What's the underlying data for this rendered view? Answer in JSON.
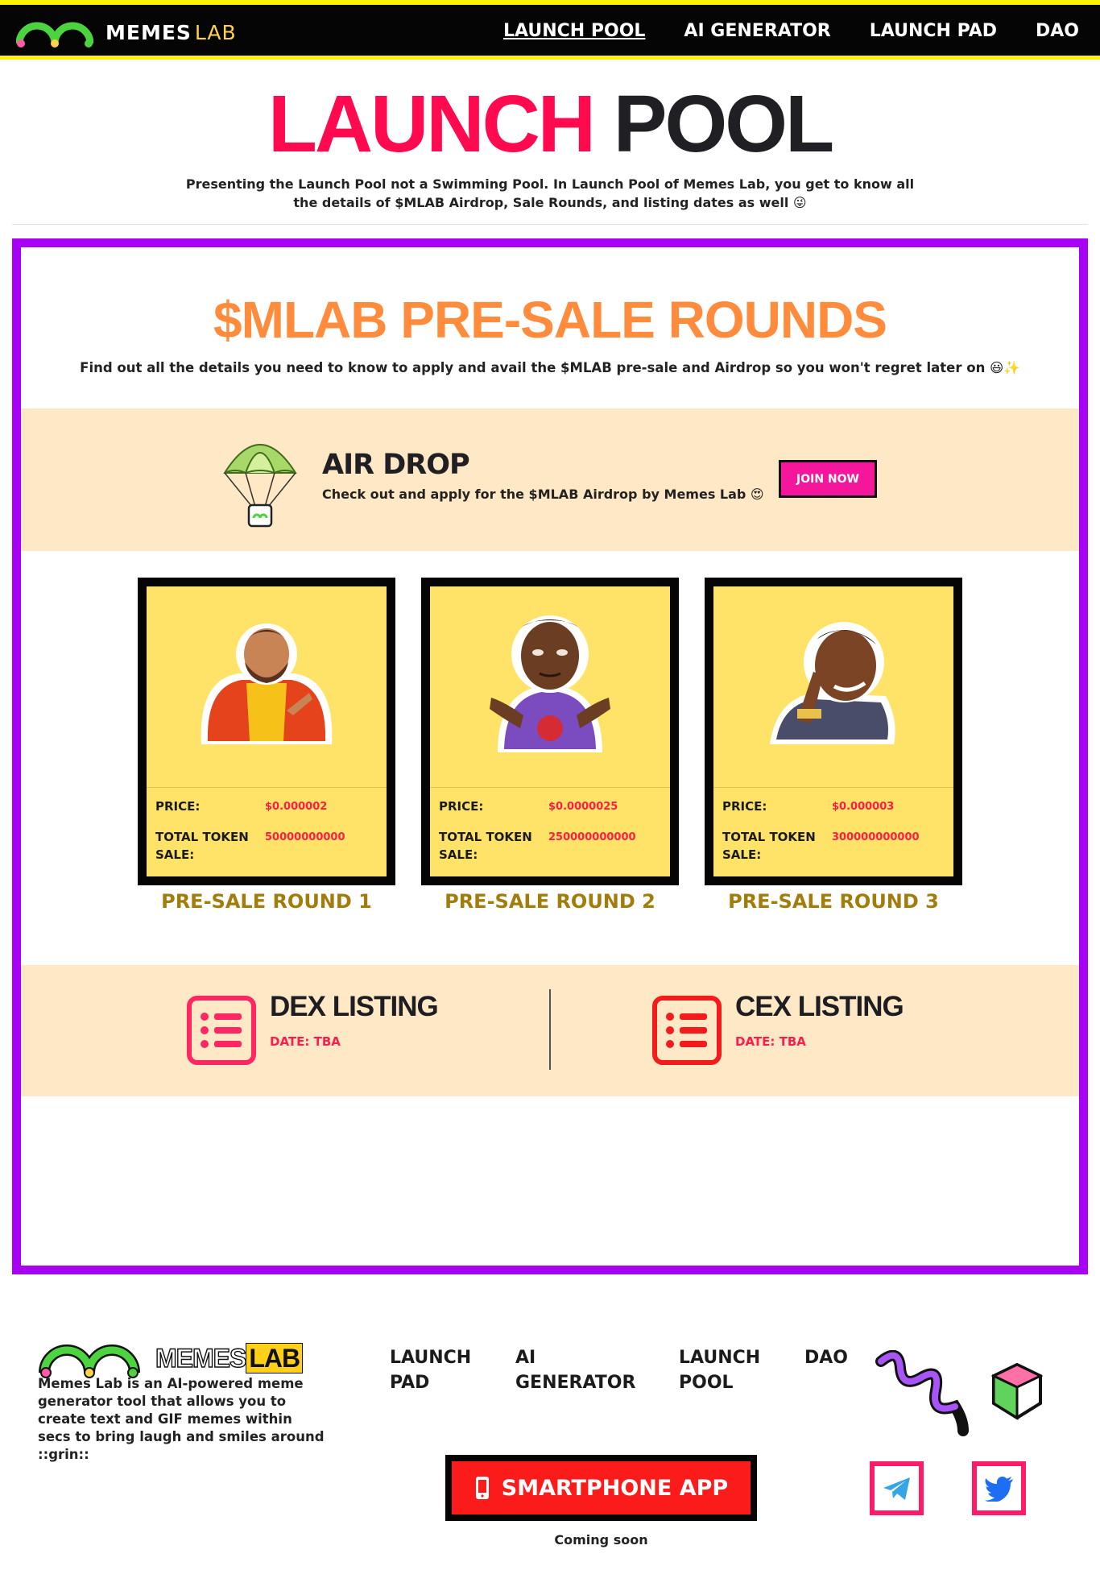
{
  "nav": {
    "brand": "MEMES",
    "brand_lab": "LAB",
    "links": [
      "LAUNCH POOL",
      "AI GENERATOR",
      "LAUNCH PAD",
      "DAO"
    ]
  },
  "hero": {
    "title_red": "LAUNCH",
    "title_dark": "POOL",
    "subtitle": "Presenting the Launch Pool not a Swimming Pool. In Launch Pool of Memes Lab, you get to know all the details of $MLAB Airdrop, Sale Rounds, and listing dates as well 😜"
  },
  "presale": {
    "title": "$MLAB PRE-SALE ROUNDS",
    "subtitle": "Find out all the details you need to know to apply and avail the $MLAB pre-sale and Airdrop so you won't regret later on 😃✨"
  },
  "airdrop": {
    "title": "AIR DROP",
    "subtitle": "Check out and apply for the $MLAB Airdrop by Memes Lab 😍",
    "button": "JOIN NOW"
  },
  "rounds": [
    {
      "price_label": "PRICE:",
      "price": "$0.000002",
      "token_label_1": "TOTAL TOKEN",
      "token_label_2": "SALE:",
      "tokens": "50000000000",
      "title": "PRE-SALE ROUND 1"
    },
    {
      "price_label": "PRICE:",
      "price": "$0.0000025",
      "token_label_1": "TOTAL TOKEN",
      "token_label_2": "SALE:",
      "tokens": "250000000000",
      "title": "PRE-SALE ROUND 2"
    },
    {
      "price_label": "PRICE:",
      "price": "$0.000003",
      "token_label_1": "TOTAL TOKEN",
      "token_label_2": "SALE:",
      "tokens": "300000000000",
      "title": "PRE-SALE ROUND 3"
    }
  ],
  "listings": [
    {
      "title": "DEX LISTING",
      "date": "DATE: TBA"
    },
    {
      "title": "CEX LISTING",
      "date": "DATE: TBA"
    }
  ],
  "footer": {
    "brand": "MEMES",
    "brand_lab": "LAB",
    "description": "Memes Lab is an AI-powered meme generator tool that allows you to create text and GIF memes within secs to bring laugh and smiles around ::grin::",
    "links": [
      "LAUNCH PAD",
      "AI GENERATOR",
      "LAUNCH POOL",
      "DAO"
    ],
    "app_button": "SMARTPHONE APP",
    "app_note": "Coming soon"
  },
  "colors": {
    "nav_bg": "#050505",
    "nav_accent": "#fff200",
    "title_red": "#ff0a4e",
    "panel_border": "#a800f5",
    "presale_orange": "#ff8c3c",
    "section_bg": "#ffe8c5",
    "join_pink": "#f5179b",
    "card_yellow": "#ffe368",
    "round_gold": "#a37d0c",
    "app_red": "#fb1b1b"
  },
  "icons": [
    "memes-lab-logo-icon",
    "parachute-icon",
    "list-icon",
    "smartphone-icon",
    "telegram-icon",
    "twitter-icon",
    "squiggle-decoration-icon",
    "cube-decoration-icon"
  ]
}
